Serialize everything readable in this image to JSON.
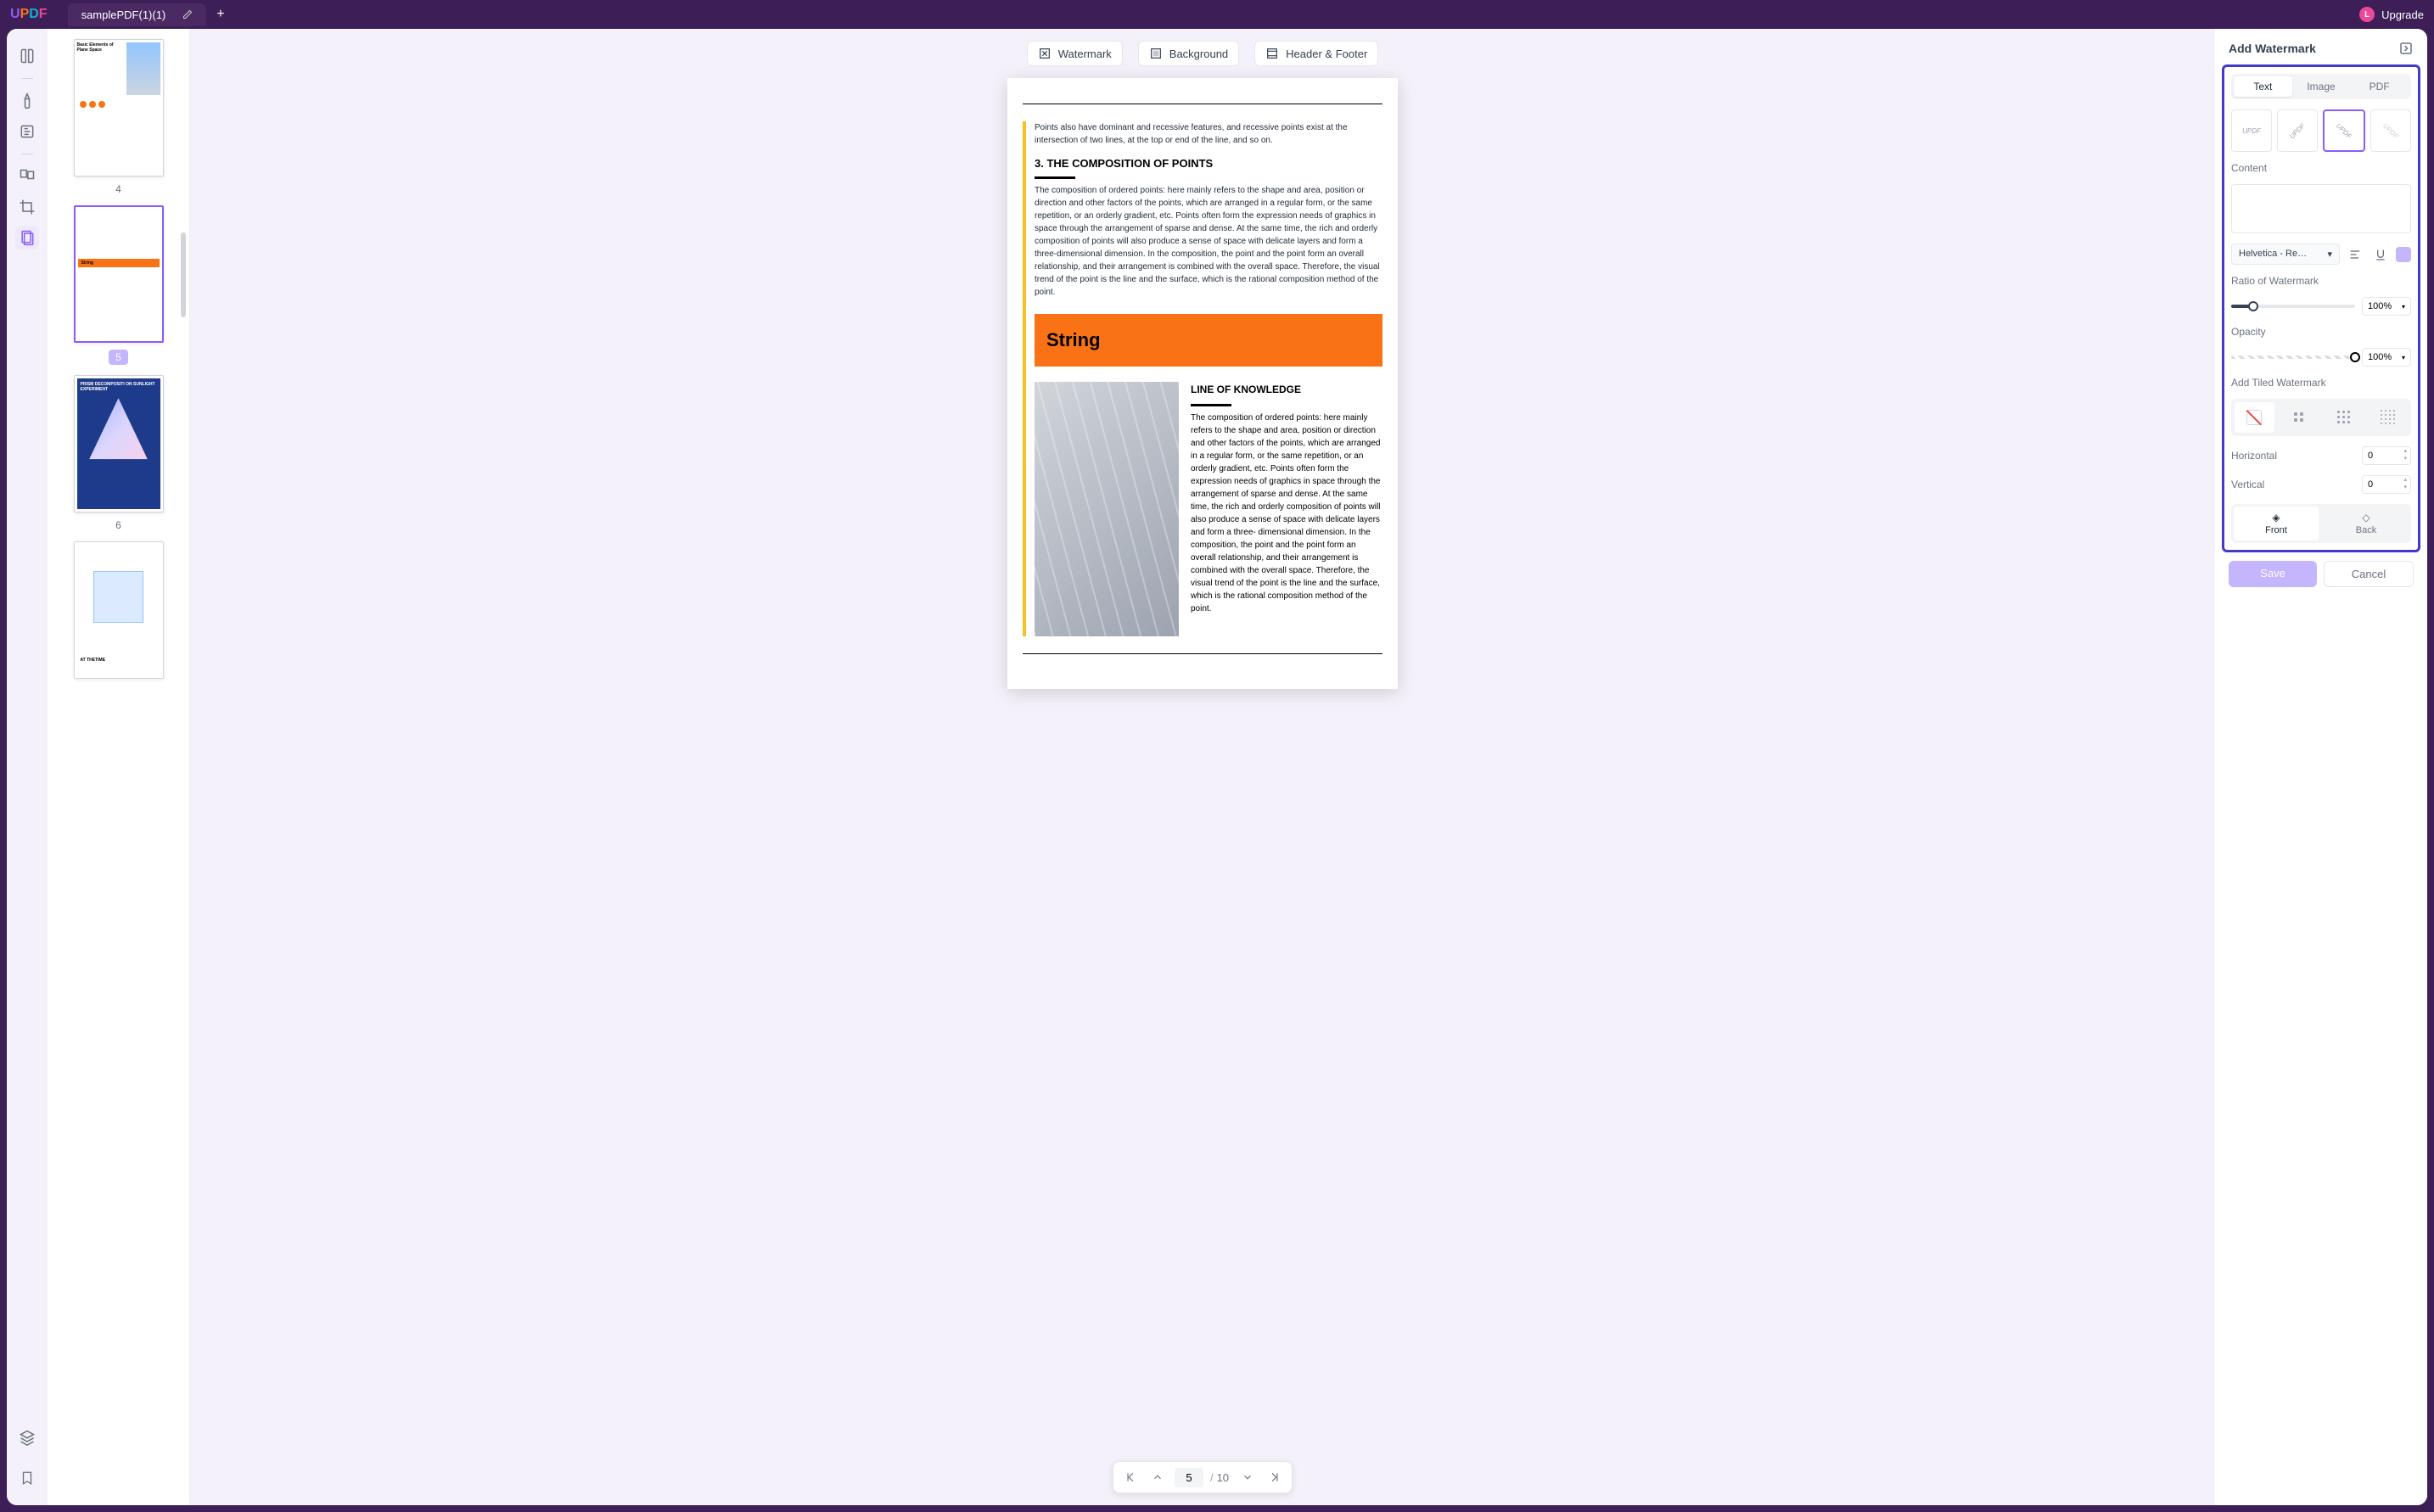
{
  "topbar": {
    "logo": "UPDF",
    "tab_title": "samplePDF(1)(1)",
    "upgrade": "Upgrade",
    "avatar_letter": "L"
  },
  "tools": {
    "watermark": "Watermark",
    "background": "Background",
    "header_footer": "Header & Footer"
  },
  "thumbs": {
    "p4": "4",
    "p5": "5",
    "p6": "6"
  },
  "page": {
    "intro": "Points also have dominant and recessive features, and recessive points exist at the intersection of two lines, at the top or end of the line, and so on.",
    "h3": "3. THE COMPOSITION OF POINTS",
    "para1": "The composition of ordered points: here mainly refers to the shape and area, position or direction and other factors of the points, which are arranged in a regular form, or the same repetition, or an orderly gradient, etc. Points often form the expression needs of graphics in space through the arrangement of sparse and dense. At the same time, the rich and orderly composition of points will also produce a sense of space with delicate layers and form a three-dimensional dimension. In the composition, the point and the point form an overall relationship, and their arrangement is combined with the overall space. Therefore, the visual trend of the point is the line and the surface, which is the rational composition method of the point.",
    "string": "String",
    "col_h": "LINE OF KNOWLEDGE",
    "col_p": "The composition of ordered points: here mainly refers to the shape and area, position or direction and other factors of the points, which are arranged in a regular form, or the same repetition, or an orderly gradient, etc. Points often form the expression needs of graphics in space through the arrangement of sparse and dense. At the same time, the rich and orderly composition of points will also produce a sense of space with delicate layers and form a three- dimensional dimension. In the composition, the point and the point form an overall relationship, and their arrangement is combined with the overall space. Therefore, the visual trend of the point is the line and the surface, which is the rational composition method of the point."
  },
  "pager": {
    "current": "5",
    "sep": "/",
    "total": "10"
  },
  "panel": {
    "title": "Add Watermark",
    "tabs": {
      "text": "Text",
      "image": "Image",
      "pdf": "PDF"
    },
    "wm_sample": "UPDF",
    "content_lbl": "Content",
    "font": "Helvetica - Re…",
    "ratio_lbl": "Ratio of Watermark",
    "ratio_val": "100%",
    "opacity_lbl": "Opacity",
    "opacity_val": "100%",
    "tile_lbl": "Add Tiled Watermark",
    "horizontal_lbl": "Horizontal",
    "horizontal_val": "0",
    "vertical_lbl": "Vertical",
    "vertical_val": "0",
    "front": "Front",
    "back": "Back",
    "save": "Save",
    "cancel": "Cancel"
  }
}
